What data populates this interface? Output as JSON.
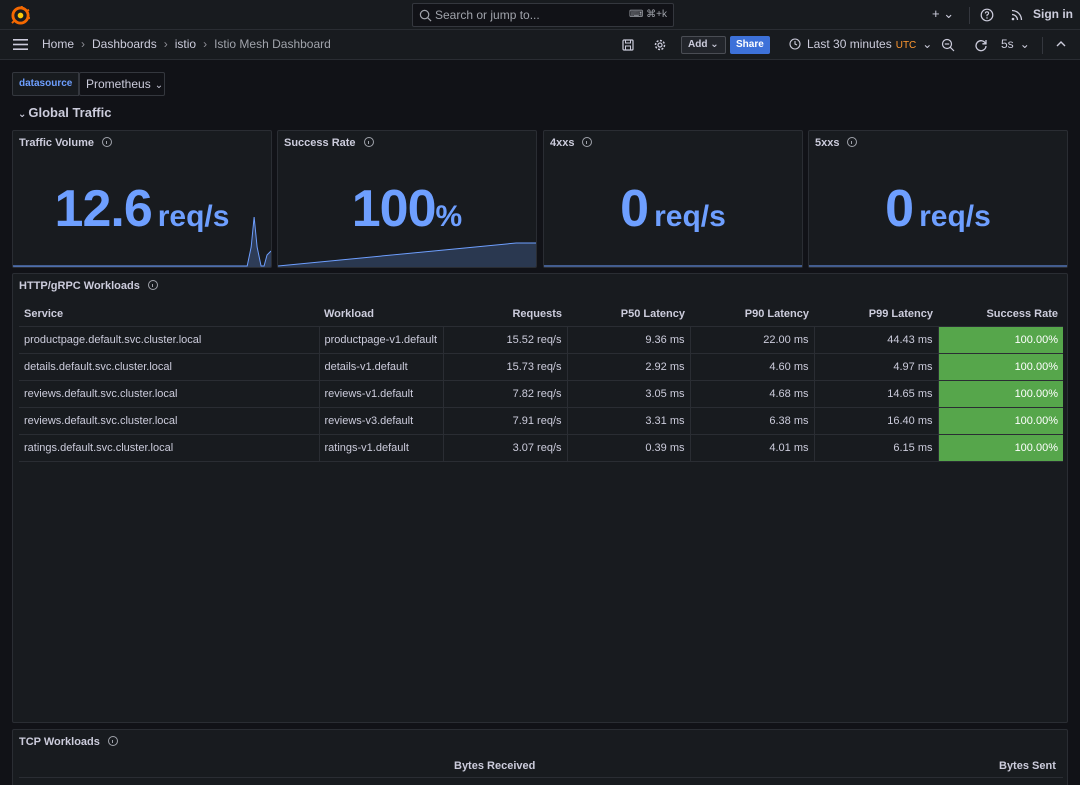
{
  "topbar": {
    "search_placeholder": "Search or jump to...",
    "search_shortcut": "⌨ ⌘+k",
    "new_label": "+ ⌄",
    "sign_in": "Sign in"
  },
  "nav": {
    "breadcrumbs": [
      "Home",
      "Dashboards",
      "istio",
      "Istio Mesh Dashboard"
    ],
    "add_label": "Add ⌄",
    "share_label": "Share",
    "time_range": "Last 30 minutes",
    "timezone": "UTC",
    "refresh_interval": "5s"
  },
  "variables": {
    "label": "datasource",
    "value": "Prometheus"
  },
  "row_title": "Global Traffic",
  "stats": [
    {
      "title": "Traffic Volume",
      "value": "12.6",
      "unit": "req/s"
    },
    {
      "title": "Success Rate",
      "value": "100",
      "unit": "%"
    },
    {
      "title": "4xxs",
      "value": "0",
      "unit": "req/s"
    },
    {
      "title": "5xxs",
      "value": "0",
      "unit": "req/s"
    }
  ],
  "http_table": {
    "title": "HTTP/gRPC Workloads",
    "columns": [
      "Service",
      "Workload",
      "Requests",
      "P50 Latency",
      "P90 Latency",
      "P99 Latency",
      "Success Rate"
    ],
    "rows": [
      [
        "productpage.default.svc.cluster.local",
        "productpage-v1.default",
        "15.52 req/s",
        "9.36 ms",
        "22.00 ms",
        "44.43 ms",
        "100.00%"
      ],
      [
        "details.default.svc.cluster.local",
        "details-v1.default",
        "15.73 req/s",
        "2.92 ms",
        "4.60 ms",
        "4.97 ms",
        "100.00%"
      ],
      [
        "reviews.default.svc.cluster.local",
        "reviews-v1.default",
        "7.82 req/s",
        "3.05 ms",
        "4.68 ms",
        "14.65 ms",
        "100.00%"
      ],
      [
        "reviews.default.svc.cluster.local",
        "reviews-v3.default",
        "7.91 req/s",
        "3.31 ms",
        "6.38 ms",
        "16.40 ms",
        "100.00%"
      ],
      [
        "ratings.default.svc.cluster.local",
        "ratings-v1.default",
        "3.07 req/s",
        "0.39 ms",
        "4.01 ms",
        "6.15 ms",
        "100.00%"
      ]
    ]
  },
  "tcp_table": {
    "title": "TCP Workloads",
    "columns": [
      "Bytes Received",
      "Bytes Sent"
    ]
  },
  "colors": {
    "accent": "#6e9fff",
    "success": "#56a64b",
    "share": "#3d71d9",
    "utc": "#ff9830"
  }
}
